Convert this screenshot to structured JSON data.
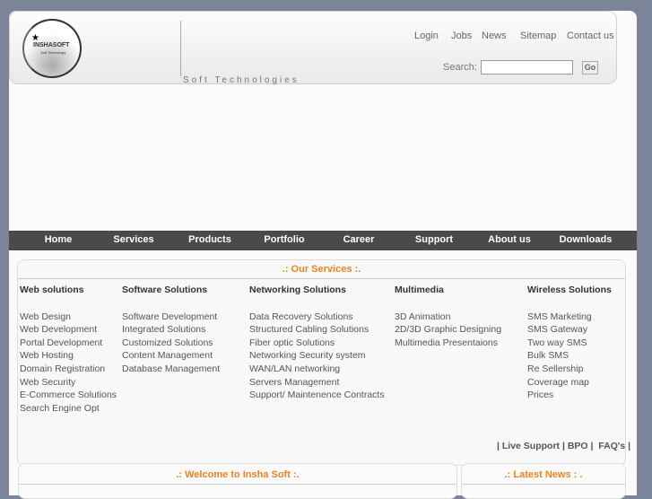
{
  "header": {
    "logo_text": "INSHASOFT",
    "logo_sub": "Soft Technology",
    "tagline": "Soft Technologies",
    "links": [
      "Login",
      "Jobs",
      "News",
      "Sitemap",
      "Contact us"
    ],
    "search_label": "Search:",
    "search_value": "",
    "go_label": "Go"
  },
  "nav": [
    "Home",
    "Services",
    "Products",
    "Portfolio",
    "Career",
    "Support",
    "About us",
    "Downloads"
  ],
  "services": {
    "title": ".:  Our Services  :.",
    "columns": [
      {
        "heading": "Web solutions",
        "items": [
          "Web Design",
          "Web Development",
          "Portal Development",
          "Web Hosting",
          "Domain Registration",
          "Web Security",
          "E-Commerce Solutions",
          "Search Engine Opt"
        ]
      },
      {
        "heading": "Software Solutions",
        "items": [
          "Software Development",
          "Integrated Solutions",
          "Customized Solutions",
          "Content Management",
          "Database Management"
        ]
      },
      {
        "heading": "Networking Solutions",
        "items": [
          "Data Recovery Solutions",
          "Structured Cabling Solutions",
          "Fiber optic Solutions",
          "Networking Security system",
          "WAN/LAN networking",
          "Servers Management",
          "Support/ Maintenence Contracts"
        ]
      },
      {
        "heading": "Multimedia",
        "items": [
          "3D Animation",
          "2D/3D Graphic Designing",
          "Multimedia Presentaions"
        ]
      },
      {
        "heading": "Wireless Solutions",
        "items": [
          "SMS Marketing",
          "SMS Gateway",
          "Two way SMS",
          "Bulk SMS",
          "Re Sellership",
          "Coverage map",
          "Prices"
        ]
      }
    ],
    "footer_links": [
      "Live Support",
      "BPO",
      "FAQ's"
    ]
  },
  "welcome_title": ".:  Welcome to Insha Soft  :.",
  "news_title": ".: Latest News : ."
}
